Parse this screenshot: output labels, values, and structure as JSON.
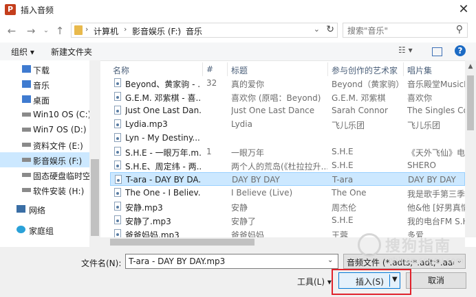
{
  "window": {
    "title": "插入音频"
  },
  "address": {
    "segments": [
      "计算机",
      "影音娱乐 (F:)",
      "音乐"
    ]
  },
  "search": {
    "placeholder": "搜索\"音乐\""
  },
  "toolbar": {
    "organize": "组织 ▾",
    "new_folder": "新建文件夹"
  },
  "sidebar": {
    "items": [
      {
        "label": "下载",
        "icon": "download-folder-icon",
        "color": "#3f7bd0"
      },
      {
        "label": "音乐",
        "icon": "music-folder-icon",
        "color": "#3f7bd0"
      },
      {
        "label": "桌面",
        "icon": "desktop-folder-icon",
        "color": "#3f7bd0"
      },
      {
        "label": "Win10 OS (C:)",
        "icon": "drive-icon",
        "color": "#8a8a8a"
      },
      {
        "label": "Win7 OS (D:)",
        "icon": "drive-icon",
        "color": "#8a8a8a"
      },
      {
        "label": "资料文件 (E:)",
        "icon": "drive-icon",
        "color": "#8a8a8a"
      },
      {
        "label": "影音娱乐 (F:)",
        "icon": "drive-icon",
        "color": "#8a8a8a",
        "selected": true
      },
      {
        "label": "固态硬盘临时空间",
        "icon": "drive-icon",
        "color": "#8a8a8a"
      },
      {
        "label": "软件安装 (H:)",
        "icon": "drive-icon",
        "color": "#8a8a8a"
      },
      {
        "label": "网络",
        "icon": "network-icon",
        "color": "#3a6ea5"
      },
      {
        "label": "家庭组",
        "icon": "homegroup-icon",
        "color": "#2aa1d8"
      }
    ]
  },
  "columns": {
    "name": "名称",
    "num": "#",
    "title": "标题",
    "artist": "参与创作的艺术家",
    "album": "唱片集"
  },
  "files": [
    {
      "name": "Beyond、黄家驹 - ...",
      "num": "32",
      "title": "真的爱你",
      "artist": "Beyond（黄家驹）",
      "album": "音乐殿堂MusicP..."
    },
    {
      "name": "G.E.M. 邓紫棋 - 喜...",
      "num": "",
      "title": "喜欢你 (原唱：Beyond)",
      "artist": "G.E.M. 邓紫棋",
      "album": "喜欢你"
    },
    {
      "name": "Just One Last Dan...",
      "num": "",
      "title": "Just One Last Dance",
      "artist": "Sarah Connor",
      "album": "The Singles Coll"
    },
    {
      "name": "Lydia.mp3",
      "num": "",
      "title": "Lydia",
      "artist": "飞儿乐团",
      "album": "飞儿乐团"
    },
    {
      "name": "Lyn - My Destiny....",
      "num": "",
      "title": "",
      "artist": "",
      "album": ""
    },
    {
      "name": "S.H.E - 一眼万年.m...",
      "num": "1",
      "title": "一眼万年",
      "artist": "S.H.E",
      "album": "《天外飞仙》电视"
    },
    {
      "name": "S.H.E、周定纬 - 两...",
      "num": "",
      "title": "两个人的荒岛(《杜拉拉升...",
      "artist": "S.H.E",
      "album": "SHERO"
    },
    {
      "name": "T-ara - DAY BY DA...",
      "num": "",
      "title": "DAY BY DAY",
      "artist": "T-ara",
      "album": "DAY BY DAY",
      "selected": true
    },
    {
      "name": "The One - I Believ...",
      "num": "",
      "title": "I Believe (Live)",
      "artist": "The One",
      "album": "我是歌手第三季 自"
    },
    {
      "name": "安静.mp3",
      "num": "",
      "title": "安静",
      "artist": "周杰伦",
      "album": "他&他 [好男真情"
    },
    {
      "name": "安静了.mp3",
      "num": "",
      "title": "安静了",
      "artist": "S.H.E",
      "album": "我的电台FM S.H.E"
    },
    {
      "name": "爸爸妈妈.mp3",
      "num": "",
      "title": "爸爸妈妈",
      "artist": "王蓉",
      "album": "多爱"
    }
  ],
  "bottom": {
    "filename_label": "文件名(N):",
    "filename_value": "T-ara - DAY BY DAY.mp3",
    "filter": "音频文件 (*.adts;*.adt;*.aac;*.aif",
    "tools": "工具(L) ▾",
    "insert": "插入(S)",
    "cancel": "取消"
  },
  "watermark": {
    "text": "搜狗指南",
    "url": "zhinan.sogou.com"
  }
}
